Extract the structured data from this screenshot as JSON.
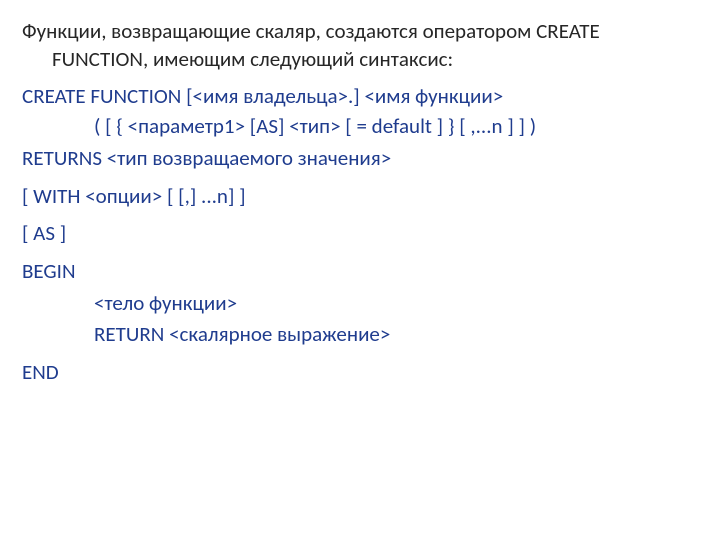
{
  "intro": "Функции, возвращающие скаляр, создаются оператором CREATE FUNCTION, имеющим следующий синтаксис:",
  "syntax": {
    "line1": "CREATE  FUNCTION [<имя владельца>.] <имя функции>",
    "params": "( [ { <параметр1> [AS] <тип> [ = default ] } [ ,...n ] ] )",
    "returns": "RETURNS <тип возвращаемого значения>",
    "with": "[ WITH <опции> [ [,] ...n] ]",
    "as": "[ AS ]",
    "begin": "BEGIN",
    "body": "<тело функции>",
    "return": "RETURN <скалярное выражение>",
    "end": "END"
  }
}
